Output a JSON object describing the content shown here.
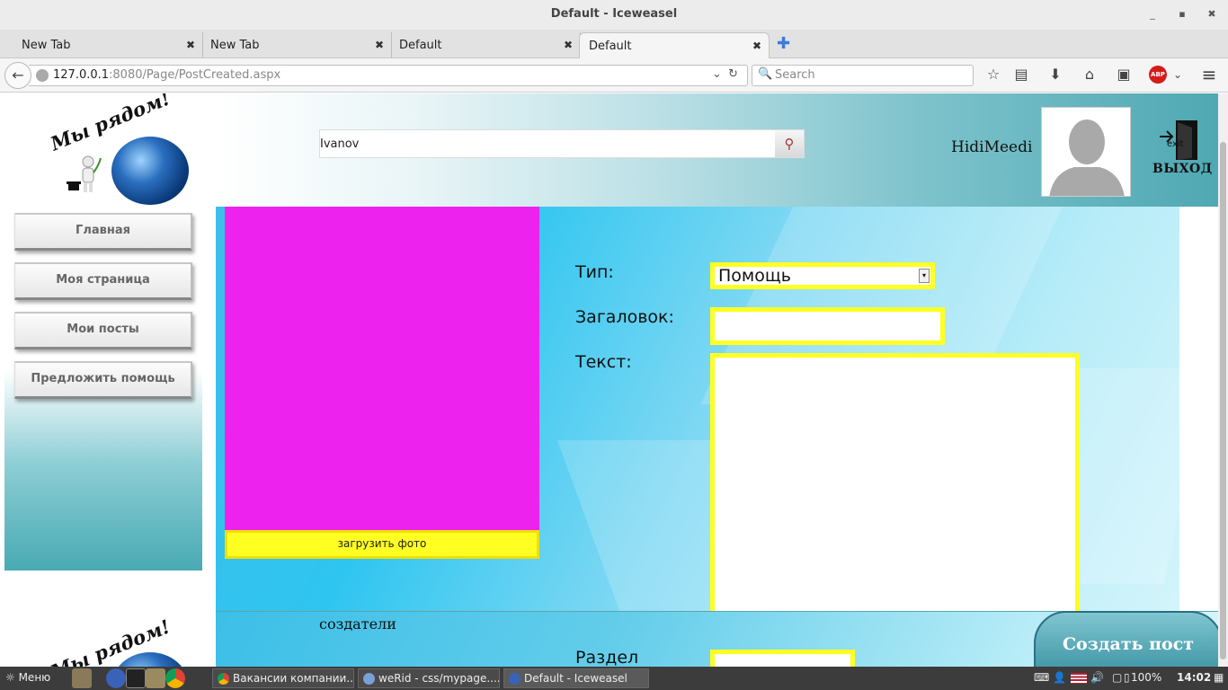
{
  "window": {
    "title": "Default - Iceweasel",
    "min": "_",
    "max": "▪",
    "close": "✖"
  },
  "tabs": [
    {
      "label": "New Tab",
      "close": "✖"
    },
    {
      "label": "New Tab",
      "close": "✖"
    },
    {
      "label": "Default",
      "close": "✖"
    },
    {
      "label": "Default",
      "close": "✖"
    }
  ],
  "newtab_glyph": "✚",
  "nav": {
    "url_host": "127.0.0.1",
    "url_rest": ":8080/Page/PostCreated.aspx",
    "search_placeholder": "Search",
    "back_glyph": "←",
    "dropdown_glyph": "⌄",
    "reload_glyph": "↻",
    "search_glyph": "🔍"
  },
  "toolbar_icons": [
    "star-icon",
    "reading-list-icon",
    "download-icon",
    "home-icon",
    "addon-icon",
    "adblock-icon",
    "menu-icon"
  ],
  "toolbar": {
    "star": "☆",
    "list": "▤",
    "download": "⬇",
    "home": "⌂",
    "addon": "▣",
    "abp": "ABP",
    "chev": "⌄",
    "menu": "≡"
  },
  "site": {
    "logo_text": "Мы рядом!",
    "search_value": "Ivanov",
    "search_glyph": "⚲",
    "username": "HidiMeedi",
    "exit_label": "ВЫХОД",
    "exit_small": "exit"
  },
  "sidebar": {
    "items": [
      {
        "label": "Главная"
      },
      {
        "label": "Моя страница"
      },
      {
        "label": "Мои посты"
      },
      {
        "label": "Предложить помощь"
      }
    ]
  },
  "form": {
    "upload_label": "загрузить фото",
    "type_label": "Тип:",
    "type_value": "Помощь",
    "title_label": "Загаловок:",
    "text_label": "Текст:",
    "section_label": "Раздел"
  },
  "footer": {
    "creators": "создатели"
  },
  "create_button": "Создать пост",
  "taskbar": {
    "menu": "Меню",
    "tasks": [
      {
        "label": "Вакансии компании..."
      },
      {
        "label": "weRid - css/mypage...."
      },
      {
        "label": "Default - Iceweasel"
      }
    ],
    "battery": "100%",
    "time": "14:02"
  },
  "colors": {
    "accent_magenta": "#ee22ee",
    "accent_yellow": "#ffff22",
    "teal": "#48aab3"
  }
}
